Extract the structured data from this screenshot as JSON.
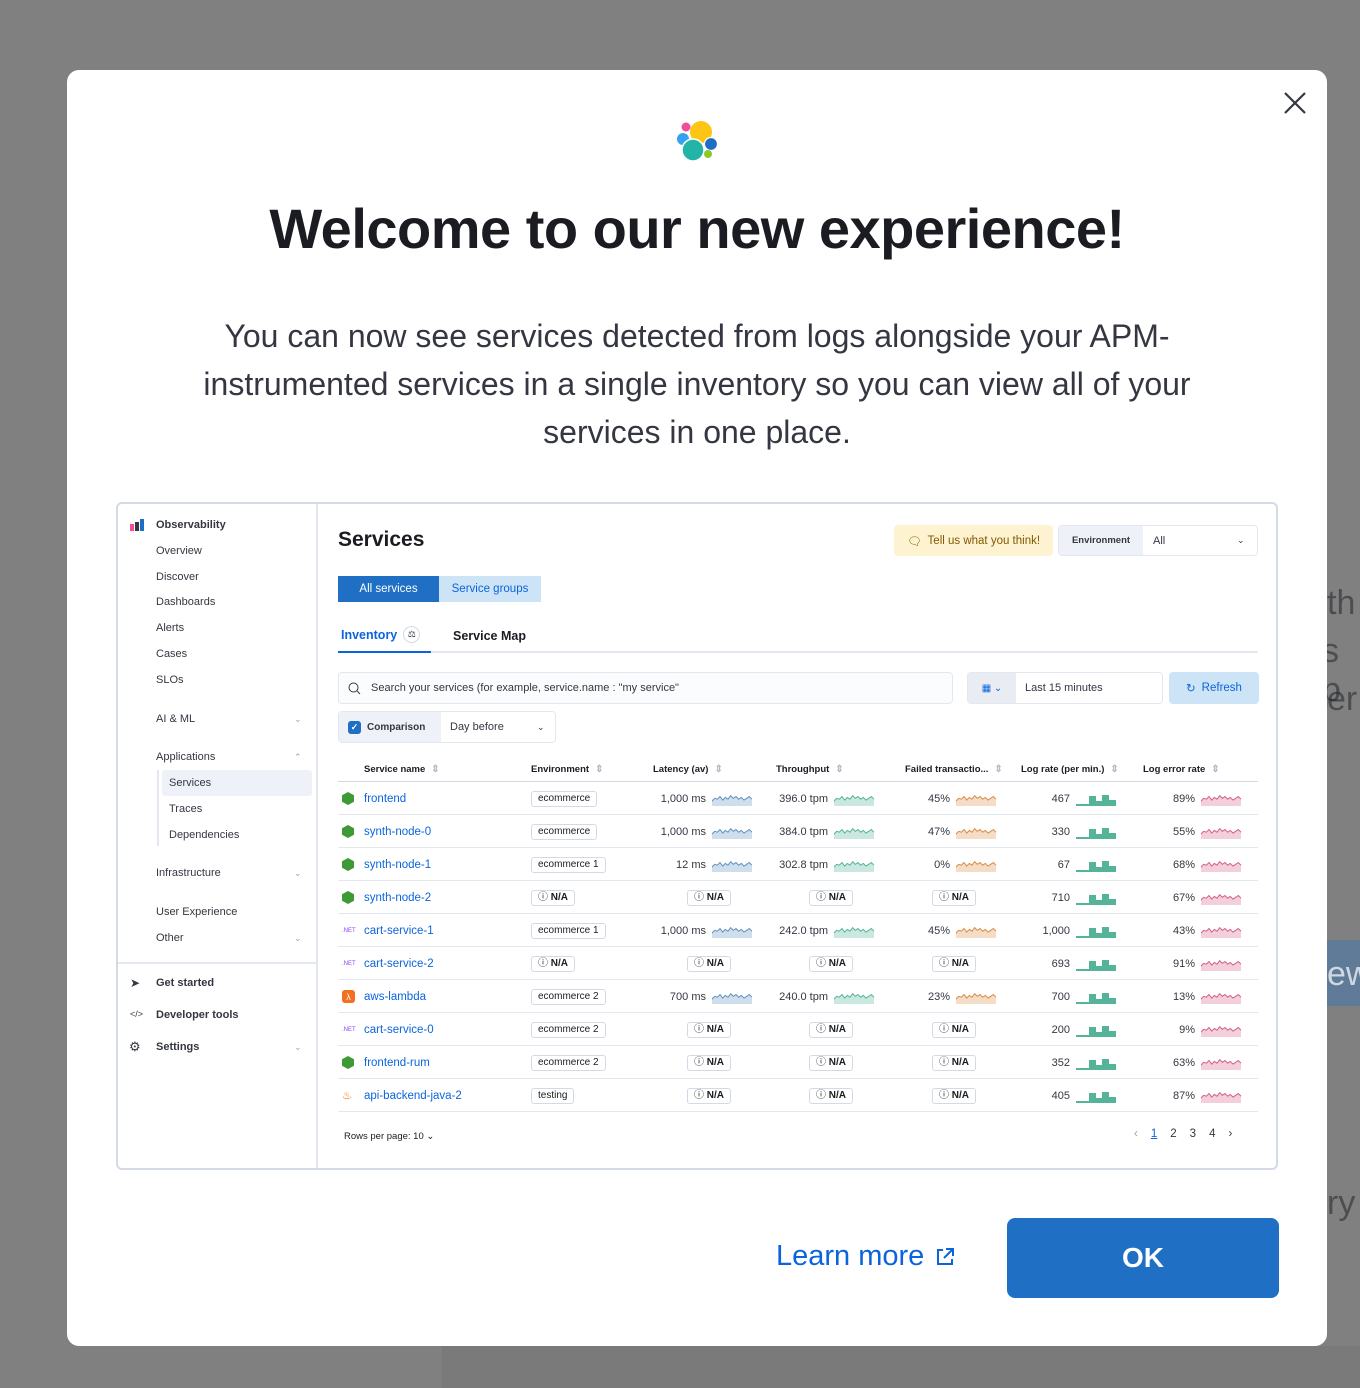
{
  "background_fragments": [
    "th",
    "s p",
    "er",
    "ew",
    "ry"
  ],
  "dialog": {
    "title": "Welcome to our new experience!",
    "body": "You can now see services detected from logs alongside your APM-instrumented services in a single inventory so you can view all of your services in one place.",
    "learn_more": "Learn more",
    "ok": "OK"
  },
  "preview": {
    "sidebar": {
      "brand": "Observability",
      "items": [
        "Overview",
        "Discover",
        "Dashboards",
        "Alerts",
        "Cases",
        "SLOs"
      ],
      "ai_ml": "AI & ML",
      "applications": "Applications",
      "app_items": [
        "Services",
        "Traces",
        "Dependencies"
      ],
      "infrastructure": "Infrastructure",
      "user_experience": "User Experience",
      "other": "Other",
      "get_started": "Get started",
      "developer_tools": "Developer tools",
      "settings": "Settings"
    },
    "title": "Services",
    "feedback": "Tell us what you think!",
    "environment_label": "Environment",
    "environment_value": "All",
    "tabs": {
      "all": "All services",
      "groups": "Service groups"
    },
    "subtabs": {
      "inventory": "Inventory",
      "map": "Service Map"
    },
    "search_placeholder": "Search your services (for example, service.name : \"my service\"",
    "time_range": "Last 15 minutes",
    "refresh": "Refresh",
    "comparison": "Comparison",
    "comparison_value": "Day before",
    "columns": [
      "Service name",
      "Environment",
      "Latency (av)",
      "Throughput",
      "Failed transactio...",
      "Log rate (per min.)",
      "Log error rate"
    ],
    "na": "N/A",
    "rows": [
      {
        "icon": "nodejs",
        "name": "frontend",
        "env": "ecommerce",
        "latency": "1,000 ms",
        "throughput": "396.0 tpm",
        "failed": "45%",
        "lograte": "467",
        "logerr": "89%"
      },
      {
        "icon": "nodejs",
        "name": "synth-node-0",
        "env": "ecommerce",
        "latency": "1,000 ms",
        "throughput": "384.0 tpm",
        "failed": "47%",
        "lograte": "330",
        "logerr": "55%"
      },
      {
        "icon": "nodejs",
        "name": "synth-node-1",
        "env": "ecommerce 1",
        "latency": "12 ms",
        "throughput": "302.8 tpm",
        "failed": "0%",
        "lograte": "67",
        "logerr": "68%"
      },
      {
        "icon": "nodejs",
        "name": "synth-node-2",
        "env": null,
        "latency": null,
        "throughput": null,
        "failed": null,
        "lograte": "710",
        "logerr": "67%"
      },
      {
        "icon": "dotnet",
        "name": "cart-service-1",
        "env": "ecommerce 1",
        "latency": "1,000 ms",
        "throughput": "242.0 tpm",
        "failed": "45%",
        "lograte": "1,000",
        "logerr": "43%"
      },
      {
        "icon": "dotnet",
        "name": "cart-service-2",
        "env": null,
        "latency": null,
        "throughput": null,
        "failed": null,
        "lograte": "693",
        "logerr": "91%"
      },
      {
        "icon": "lambda",
        "name": "aws-lambda",
        "env": "ecommerce 2",
        "latency": "700 ms",
        "throughput": "240.0 tpm",
        "failed": "23%",
        "lograte": "700",
        "logerr": "13%"
      },
      {
        "icon": "dotnet",
        "name": "cart-service-0",
        "env": "ecommerce 2",
        "latency": null,
        "throughput": null,
        "failed": null,
        "lograte": "200",
        "logerr": "9%"
      },
      {
        "icon": "nodejs",
        "name": "frontend-rum",
        "env": "ecommerce 2",
        "latency": null,
        "throughput": null,
        "failed": null,
        "lograte": "352",
        "logerr": "63%"
      },
      {
        "icon": "java",
        "name": "api-backend-java-2",
        "env": "testing",
        "latency": null,
        "throughput": null,
        "failed": null,
        "lograte": "405",
        "logerr": "87%"
      }
    ],
    "dotnet_label": ".NET",
    "rows_per_page": "Rows per page: 10",
    "pages": [
      "1",
      "2",
      "3",
      "4"
    ],
    "current_page": "1"
  },
  "colors": {
    "primary": "#1f6fc5",
    "link": "#0b64dd",
    "latency": "#6092c0",
    "throughput": "#54b399",
    "failed": "#da8b45",
    "lograte": "#54b399",
    "logerr": "#d36086",
    "feedback_bg": "#fdf3d0"
  }
}
